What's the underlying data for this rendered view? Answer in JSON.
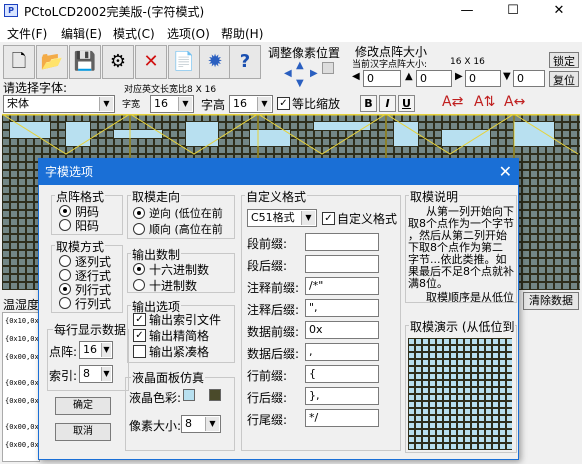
{
  "window": {
    "title": "PCtoLCD2002完美版-(字符模式)",
    "min": "—",
    "max": "☐",
    "close": "✕"
  },
  "menu": [
    "文件(F)",
    "编辑(E)",
    "模式(C)",
    "选项(O)",
    "帮助(H)"
  ],
  "toolbar": {
    "adjust_title": "调整像素位置",
    "resize_title": "修改点阵大小",
    "current_size_label": "当前汉字点阵大小:",
    "current_size": "16 X 16",
    "w_value": "0",
    "h_value": "0",
    "c3_value": "0",
    "c4_value": "0",
    "lock_btn": "锁定",
    "reset_btn": "复位",
    "cn_font_size": "对应英文长宽比8 X 16"
  },
  "fontrow": {
    "choose_font": "请选择字体:",
    "font_name": "宋体",
    "width_label": "字宽",
    "width_value": "16",
    "height_label": "字高",
    "height_value": "16",
    "proportional_label": "等比缩放",
    "bold": "B",
    "italic": "I",
    "underline": "U"
  },
  "side": {
    "temp_label": "温湿度",
    "clear_btn": "清除数据"
  },
  "log_lines": [
    "{0x10,0x40,0x1,",
    "{0x10,0x40,0x1,",
    "{0x00,0x00,0x0,",
    "{0x00,0x00,0x0,",
    "{0x00,0x00,0x0,",
    "{0x00,0x00,0x0,",
    "{0x00,0x40,0x0,"
  ],
  "dialog": {
    "title": "字模选项",
    "close": "✕",
    "dot_format": {
      "title": "点阵格式",
      "options": [
        "阴码",
        "阳码"
      ],
      "selected": 0
    },
    "mode": {
      "title": "取模方式",
      "options": [
        "逐列式",
        "逐行式",
        "列行式",
        "行列式"
      ],
      "selected": 2
    },
    "direction": {
      "title": "取模走向",
      "options": [
        "逆向 (低位在前",
        "顺向 (高位在前"
      ],
      "selected": 0
    },
    "number": {
      "title": "输出数制",
      "options": [
        "十六进制数",
        "十进制数"
      ],
      "selected": 0
    },
    "output": {
      "title": "输出选项",
      "options": [
        "输出索引文件",
        "输出精简格",
        "输出紧凑格"
      ],
      "checked": [
        true,
        true,
        false
      ]
    },
    "per_line": {
      "title": "每行显示数据",
      "dots_label": "点阵:",
      "dots_value": "16",
      "index_label": "索引:",
      "index_value": "8"
    },
    "ok_btn": "确定",
    "cancel_btn": "取消",
    "lcd": {
      "title": "液晶面板仿真",
      "color_label": "液晶色彩:",
      "pixel_label": "像素大小:",
      "pixel_value": "8",
      "color1": "#b8e0f0",
      "color2": "#4a4a2a"
    },
    "custom": {
      "title": "自定义格式",
      "format_select": "C51格式",
      "custom_check": "自定义格式",
      "fields": [
        {
          "label": "段前缀:",
          "value": ""
        },
        {
          "label": "段后缀:",
          "value": ""
        },
        {
          "label": "注释前缀:",
          "value": "/*\""
        },
        {
          "label": "注释后缀:",
          "value": "\","
        },
        {
          "label": "数据前缀:",
          "value": "0x"
        },
        {
          "label": "数据后缀:",
          "value": ","
        },
        {
          "label": "行前缀:",
          "value": "{"
        },
        {
          "label": "行后缀:",
          "value": "},"
        },
        {
          "label": "行尾缀:",
          "value": "*/"
        }
      ]
    },
    "explain": {
      "title": "取模说明",
      "lines": [
        "从第一列开始向下",
        "取8个点作为一个字节",
        "，然后从第二列开始",
        "下取8个点作为第二",
        "字节...依此类推。如",
        "果最后不足8个点就补",
        "满8位。"
      ],
      "order": "取模顺序是从低位"
    },
    "demo_title": "取模演示 (从低位到"
  }
}
